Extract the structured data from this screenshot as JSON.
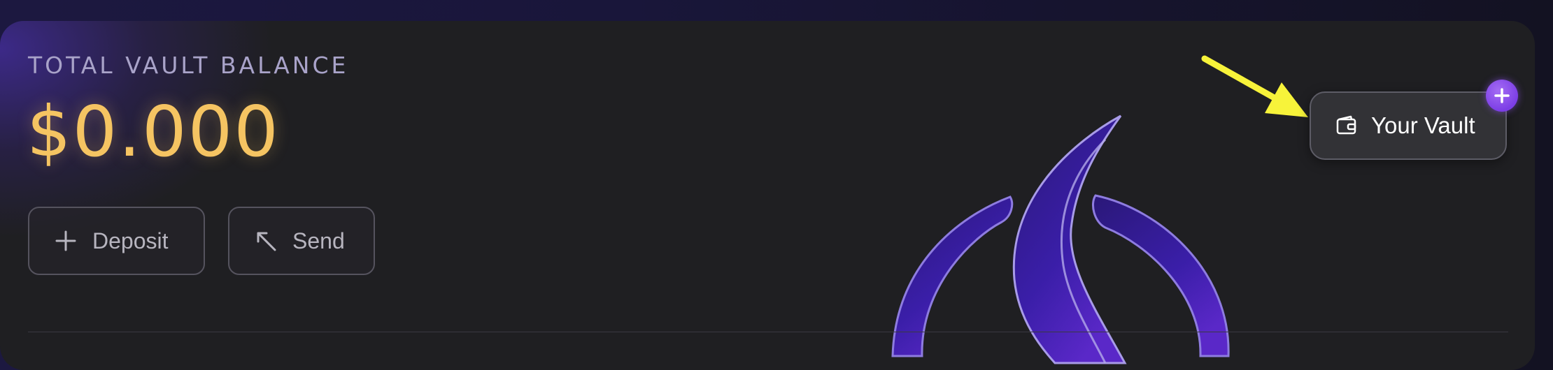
{
  "vault": {
    "title": "TOTAL VAULT BALANCE",
    "balance": "$0.000",
    "actions": {
      "deposit_label": "Deposit",
      "send_label": "Send"
    },
    "your_vault_label": "Your Vault"
  },
  "icons": {
    "deposit": "plus-icon",
    "send": "arrow-up-left-icon",
    "your_vault": "wallet-icon",
    "badge": "plus-icon",
    "annotation": "yellow-arrow-icon",
    "brand": "flame-logo"
  },
  "colors": {
    "balance": "#f5c462",
    "card_bg": "#1f1f22",
    "accent_purple": "#7c3ee6",
    "annotation_arrow": "#f7f33a"
  }
}
